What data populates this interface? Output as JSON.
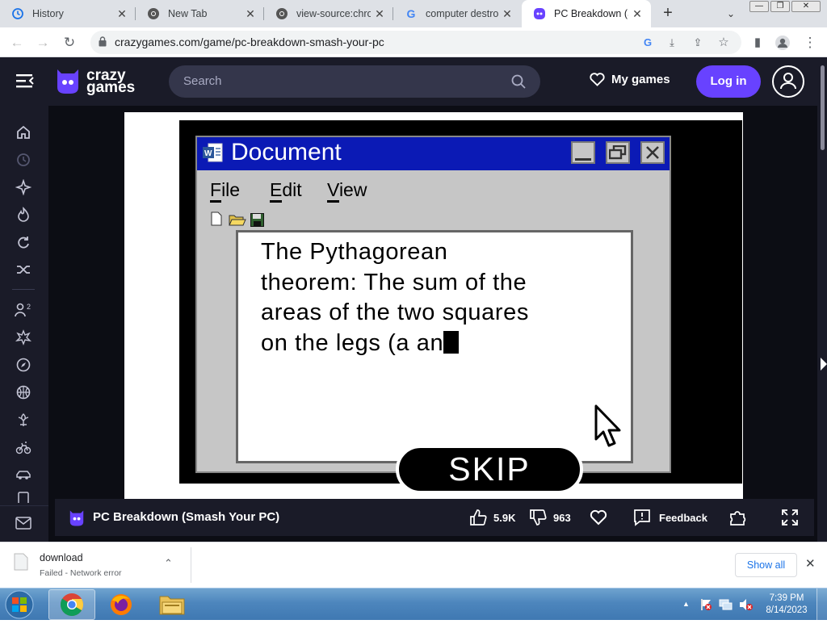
{
  "browser": {
    "tabs": [
      {
        "title": "History",
        "icon": "history-icon"
      },
      {
        "title": "New Tab",
        "icon": "chrome-icon"
      },
      {
        "title": "view-source:chrome",
        "icon": "chrome-icon"
      },
      {
        "title": "computer destroy",
        "icon": "google-icon"
      },
      {
        "title": "PC Breakdown (Sm",
        "icon": "crazygames-icon",
        "active": true
      }
    ],
    "url": "crazygames.com/game/pc-breakdown-smash-your-pc"
  },
  "site": {
    "logo_line1": "crazy",
    "logo_line2": "games",
    "search_placeholder": "Search",
    "my_games": "My games",
    "login": "Log in"
  },
  "game": {
    "window_title": "Document",
    "menu": {
      "file": "File",
      "edit": "Edit",
      "view": "View"
    },
    "doc_lines": [
      "The Pythagorean",
      "theorem: The sum of the",
      "areas of the two squares",
      "on the legs (a an"
    ],
    "skip": "SKIP"
  },
  "game_bar": {
    "title": "PC Breakdown (Smash Your PC)",
    "likes": "5.9K",
    "dislikes": "963",
    "feedback": "Feedback"
  },
  "download": {
    "filename": "download",
    "status": "Failed - Network error",
    "show_all": "Show all"
  },
  "taskbar": {
    "time": "7:39 PM",
    "date": "8/14/2023"
  },
  "colors": {
    "brand_purple": "#6842ff",
    "site_bg": "#1a1b28",
    "game_window_title": "#0b1ab5"
  }
}
